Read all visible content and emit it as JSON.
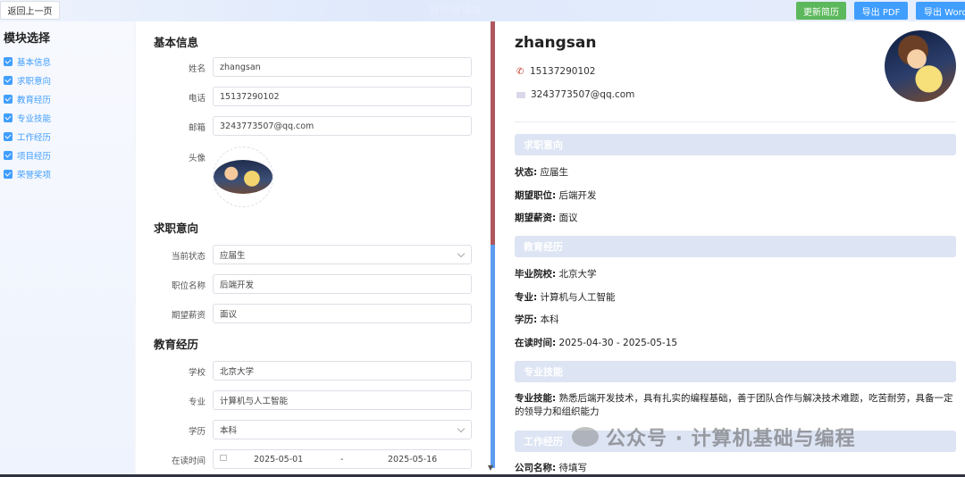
{
  "topbar": {
    "back_label": "返回上一页",
    "title": "简历编辑器",
    "update_label": "更新简历",
    "export_pdf_label": "导出 PDF",
    "export_word_label": "导出 Word"
  },
  "sidebar": {
    "title": "模块选择",
    "items": [
      {
        "label": "基本信息",
        "checked": true
      },
      {
        "label": "求职意向",
        "checked": true
      },
      {
        "label": "教育经历",
        "checked": true
      },
      {
        "label": "专业技能",
        "checked": true
      },
      {
        "label": "工作经历",
        "checked": true
      },
      {
        "label": "项目经历",
        "checked": true
      },
      {
        "label": "荣誉奖项",
        "checked": true
      }
    ]
  },
  "editor": {
    "basic": {
      "title": "基本信息",
      "name_label": "姓名",
      "name_value": "zhangsan",
      "phone_label": "电话",
      "phone_value": "15137290102",
      "email_label": "邮箱",
      "email_value": "3243773507@qq.com",
      "avatar_label": "头像"
    },
    "intent": {
      "title": "求职意向",
      "status_label": "当前状态",
      "status_value": "应届生",
      "position_label": "职位名称",
      "position_value": "后端开发",
      "salary_label": "期望薪资",
      "salary_value": "面议"
    },
    "education": {
      "title": "教育经历",
      "school_label": "学校",
      "school_value": "北京大学",
      "major_label": "专业",
      "major_value": "计算机与人工智能",
      "degree_label": "学历",
      "degree_value": "本科",
      "period_label": "在读时间",
      "start_date": "2025-05-01",
      "separator": "-",
      "end_date": "2025-05-16"
    }
  },
  "preview": {
    "name": "zhangsan",
    "phone": "15137290102",
    "email": "3243773507@qq.com",
    "intent_title": "求职意向",
    "status_key": "状态:",
    "status_val": "应届生",
    "position_key": "期望职位:",
    "position_val": "后端开发",
    "salary_key": "期望薪资:",
    "salary_val": "面议",
    "edu_title": "教育经历",
    "school_key": "毕业院校:",
    "school_val": "北京大学",
    "major_key": "专业:",
    "major_val": "计算机与人工智能",
    "degree_key": "学历:",
    "degree_val": "本科",
    "period_key": "在读时间:",
    "period_val": "2025-04-30 - 2025-05-15",
    "skills_title": "专业技能",
    "skills_key": "专业技能:",
    "skills_val": "熟悉后端开发技术，具有扎实的编程基础，善于团队合作与解决技术难题，吃苦耐劳，具备一定的领导力和组织能力",
    "work_title": "工作经历",
    "company_key": "公司名称:",
    "company_val": "待填写"
  },
  "watermark": "公众号 · 计算机基础与编程",
  "colors": {
    "accent": "#409eff",
    "update": "#5cb85c",
    "section_bg": "#dde4f3"
  }
}
